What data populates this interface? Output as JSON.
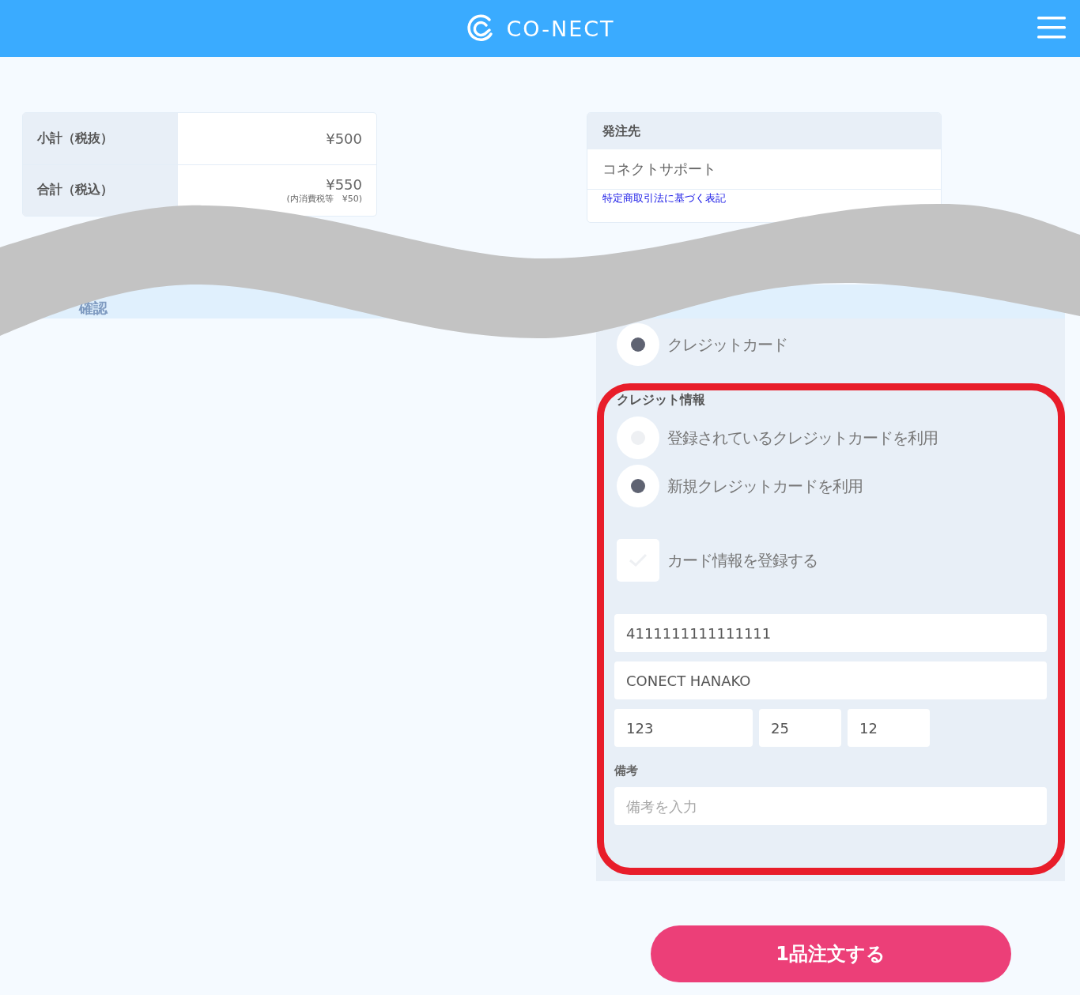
{
  "header": {
    "logo_text": "CO-NECT"
  },
  "summary": [
    {
      "label": "小計（税抜）",
      "value": "¥500"
    },
    {
      "label": "合計（税込）",
      "value": "¥550",
      "note": "(内消費税等　¥50)"
    }
  ],
  "supplier": {
    "heading": "発注先",
    "name": "コネクトサポート",
    "link": "特定商取引法に基づく表記"
  },
  "section_title": "確認",
  "payment_methods": [
    {
      "label": "クレジットカード",
      "selected": true
    }
  ],
  "credit_info": {
    "title": "クレジット情報",
    "options": [
      {
        "label": "登録されているクレジットカードを利用",
        "selected": false
      },
      {
        "label": "新規クレジットカードを利用",
        "selected": true
      }
    ],
    "save_card": {
      "label": "カード情報を登録する",
      "checked": false
    },
    "card_number": "4111111111111111",
    "card_name": "CONECT HANAKO",
    "cvc": "123",
    "expiry_year": "25",
    "expiry_month": "12"
  },
  "remarks": {
    "label": "備考",
    "placeholder": "備考を入力"
  },
  "order_button": "1品注文する"
}
